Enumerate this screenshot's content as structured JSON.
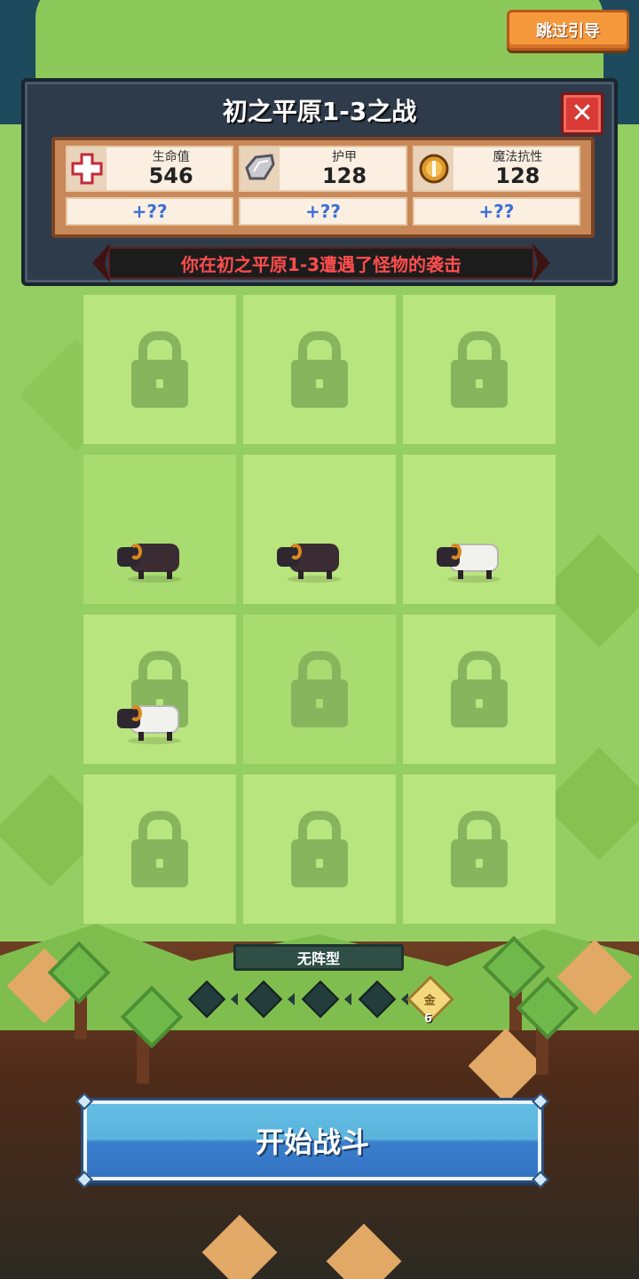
{
  "header": {
    "skip_label": "跳过引导"
  },
  "panel": {
    "title": "初之平原1-3之战",
    "close_icon": "close-icon",
    "stats": [
      {
        "icon": "health-cross-icon",
        "label": "生命值",
        "value": "546",
        "bonus": "+??"
      },
      {
        "icon": "armor-shard-icon",
        "label": "护甲",
        "value": "128",
        "bonus": "+??"
      },
      {
        "icon": "magic-resist-icon",
        "label": "魔法抗性",
        "value": "128",
        "bonus": "+??"
      }
    ],
    "encounter_text": "你在初之平原1-3遭遇了怪物的袭击"
  },
  "grid": {
    "rows": 4,
    "cols": 3,
    "slots": [
      {
        "state": "locked"
      },
      {
        "state": "locked"
      },
      {
        "state": "locked"
      },
      {
        "state": "monster",
        "monster": "black-ram"
      },
      {
        "state": "monster",
        "monster": "black-ram"
      },
      {
        "state": "monster",
        "monster": "white-ram"
      },
      {
        "state": "locked-with-monster",
        "monster": "white-ram"
      },
      {
        "state": "locked"
      },
      {
        "state": "locked"
      },
      {
        "state": "locked"
      },
      {
        "state": "locked"
      },
      {
        "state": "locked"
      }
    ]
  },
  "formation": {
    "label": "无阵型",
    "pips": 4,
    "gold_symbol": "金",
    "gold_count": "6"
  },
  "start_button": {
    "label": "开始战斗"
  },
  "colors": {
    "grass": "#95ce62",
    "slot": "#b9e57e",
    "lock": "#86b55e",
    "skip_button": "#f59a3c",
    "start_button": "#3a7fcd",
    "encounter_text": "#ff4d4d",
    "bonus_text": "#3b6fd6"
  }
}
